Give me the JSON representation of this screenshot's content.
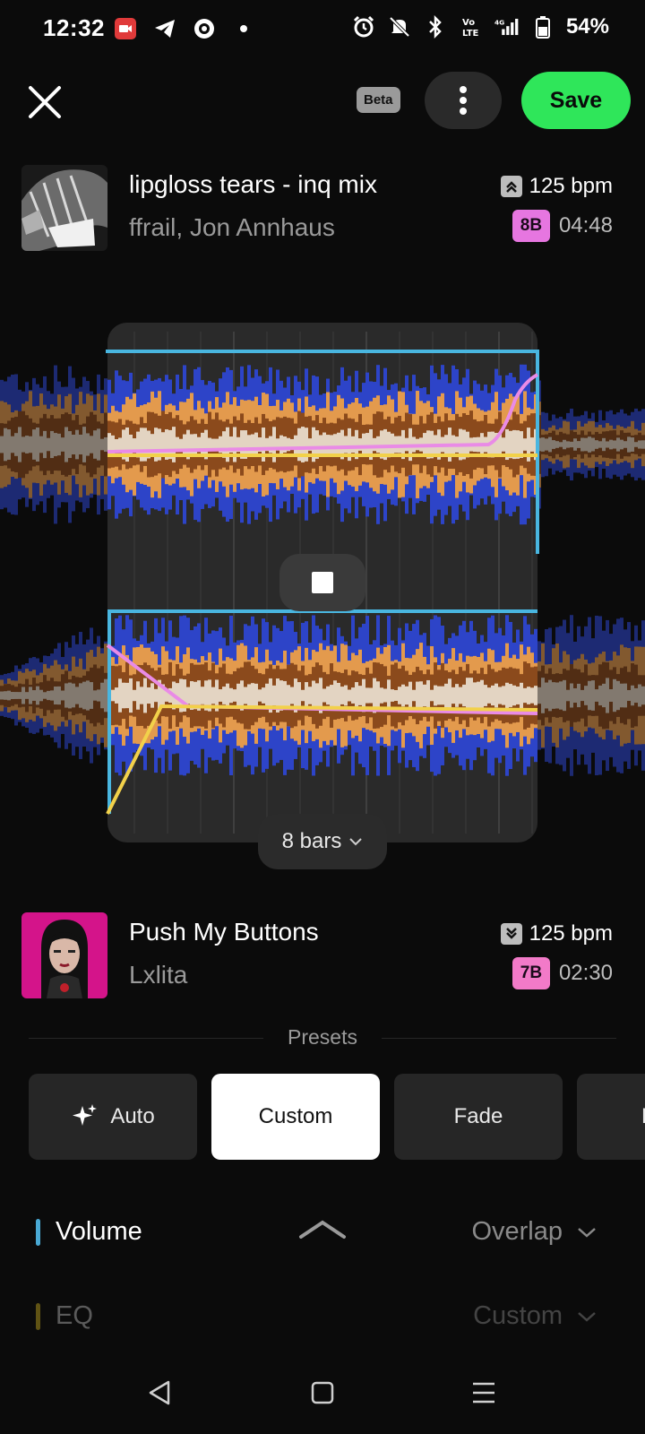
{
  "status": {
    "time": "12:32",
    "battery": "54%",
    "icons_left": [
      "video-record-icon",
      "telegram-icon",
      "vpn-icon",
      "dot-icon"
    ],
    "icons_right": [
      "alarm-icon",
      "mute-icon",
      "bluetooth-icon",
      "volte-icon",
      "signal-4g-icon",
      "battery-icon"
    ]
  },
  "topbar": {
    "beta_label": "Beta",
    "save_label": "Save"
  },
  "track_a": {
    "title": "lipgloss tears - inq mix",
    "artist": "ffrail, Jon Annhaus",
    "bpm": "125 bpm",
    "bpm_direction": "up",
    "key": "8B",
    "key_color": "#e676e0",
    "duration": "04:48"
  },
  "transition": {
    "length_label": "8 bars"
  },
  "track_b": {
    "title": "Push My Buttons",
    "artist": "Lxlita",
    "bpm": "125 bpm",
    "bpm_direction": "down",
    "key": "7B",
    "key_color": "#f27ac8",
    "duration": "02:30"
  },
  "presets": {
    "label": "Presets",
    "items": [
      {
        "label": "Auto",
        "active": false
      },
      {
        "label": "Custom",
        "active": true
      },
      {
        "label": "Fade",
        "active": false
      },
      {
        "label": "F",
        "active": false
      }
    ]
  },
  "params": [
    {
      "label": "Volume",
      "value": "Overlap",
      "accent": "#49a9d4"
    },
    {
      "label": "EQ",
      "value": "Custom",
      "accent": "#8a7a18"
    }
  ],
  "colors": {
    "accent_green": "#2fe65a",
    "volume_line": "#49b6e0",
    "curve_pink": "#e98be6",
    "curve_yellow": "#f2d14a"
  }
}
